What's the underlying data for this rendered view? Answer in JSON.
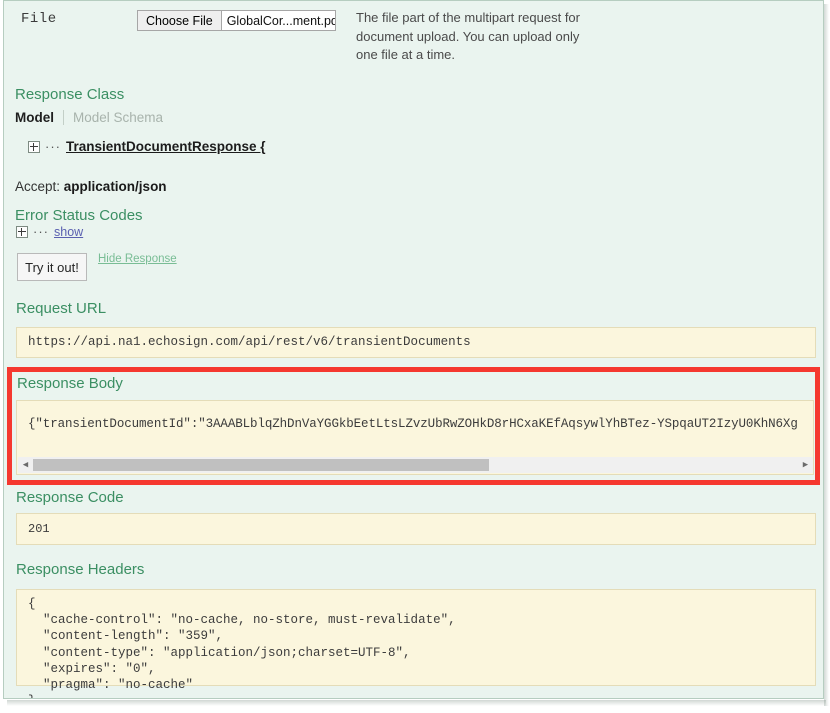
{
  "file_row": {
    "label": "File",
    "choose_button": "Choose File",
    "file_name": "GlobalCor...ment.pdf",
    "description": "The file part of the multipart request for document upload. You can upload only one file at a time."
  },
  "response_class": {
    "heading": "Response Class",
    "tabs": {
      "model": "Model",
      "model_schema": "Model Schema"
    },
    "tree_dots": "···",
    "model_name": "TransientDocumentResponse {",
    "accept_label": "Accept:",
    "accept_value": "application/json"
  },
  "error_status": {
    "heading": "Error Status Codes",
    "dots": "···",
    "show_link": "show"
  },
  "actions": {
    "try_it_out": "Try it out!",
    "hide_response": "Hide Response"
  },
  "request_url": {
    "heading": "Request URL",
    "value": "https://api.na1.echosign.com/api/rest/v6/transientDocuments"
  },
  "response_body": {
    "heading": "Response Body",
    "value": "{\"transientDocumentId\":\"3AAABLblqZhDnVaYGGkbEetLtsLZvzUbRwZOHkD8rHCxaKEfAqsywlYhBTez-YSpqaUT2IzyU0KhN6Xg",
    "scroll_left_arrow": "◀",
    "scroll_right_arrow": "▶",
    "highlight_color": "#f5382f"
  },
  "response_code": {
    "heading": "Response Code",
    "value": "201"
  },
  "response_headers": {
    "heading": "Response Headers",
    "value": "{\n  \"cache-control\": \"no-cache, no-store, must-revalidate\",\n  \"content-length\": \"359\",\n  \"content-type\": \"application/json;charset=UTF-8\",\n  \"expires\": \"0\",\n  \"pragma\": \"no-cache\"\n}"
  },
  "colors": {
    "page_background": "#eaf4ef",
    "heading_green": "#3b8f63",
    "code_background": "#fbf6dd",
    "highlight_red": "#f5382f",
    "link_blue": "#5a5fb0"
  }
}
